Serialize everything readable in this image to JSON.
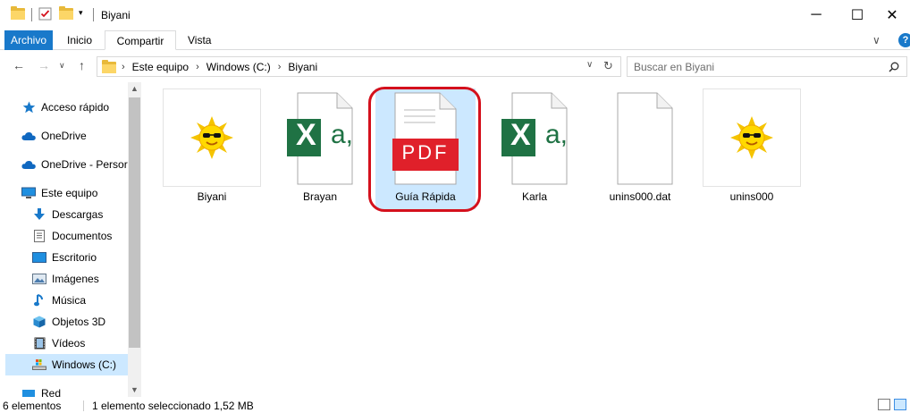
{
  "window": {
    "title": "Biyani",
    "minimize": "─",
    "maximize": "☐",
    "close": "✕"
  },
  "ribbon": {
    "tabs": [
      "Archivo",
      "Inicio",
      "Compartir",
      "Vista"
    ],
    "help": "?",
    "expand": "∨"
  },
  "address": {
    "crumbs": [
      "Este equipo",
      "Windows (C:)",
      "Biyani"
    ],
    "separator": "›",
    "search_placeholder": "Buscar en Biyani"
  },
  "nav": {
    "items": [
      {
        "label": "Acceso rápido",
        "icon": "star-icon"
      },
      {
        "label": "OneDrive",
        "icon": "cloud-icon"
      },
      {
        "label": "OneDrive - Persor",
        "icon": "cloud-icon"
      },
      {
        "label": "Este equipo",
        "icon": "computer-icon"
      },
      {
        "label": "Descargas",
        "icon": "download-icon"
      },
      {
        "label": "Documentos",
        "icon": "document-icon"
      },
      {
        "label": "Escritorio",
        "icon": "desktop-icon"
      },
      {
        "label": "Imágenes",
        "icon": "pictures-icon"
      },
      {
        "label": "Música",
        "icon": "music-icon"
      },
      {
        "label": "Objetos 3D",
        "icon": "cube-icon"
      },
      {
        "label": "Vídeos",
        "icon": "video-icon"
      },
      {
        "label": "Windows (C:)",
        "icon": "drive-icon"
      },
      {
        "label": "Red",
        "icon": "network-icon"
      }
    ]
  },
  "files": [
    {
      "name": "Biyani",
      "type": "sun-image"
    },
    {
      "name": "Brayan",
      "type": "excel"
    },
    {
      "name": "Guía Rápida",
      "type": "pdf",
      "thumb_text": "PDF"
    },
    {
      "name": "Karla",
      "type": "excel"
    },
    {
      "name": "unins000.dat",
      "type": "blank"
    },
    {
      "name": "unins000",
      "type": "sun-image"
    }
  ],
  "excel_glyphs": {
    "letter": "X",
    "suffix": "a,"
  },
  "status": {
    "count": "6 elementos",
    "selection": "1 elemento seleccionado  1,52 MB"
  },
  "colors": {
    "accent": "#1979ca",
    "selection": "#cce8ff",
    "highlight": "#d4101c",
    "excel": "#1f7244",
    "pdf": "#e0202a"
  }
}
